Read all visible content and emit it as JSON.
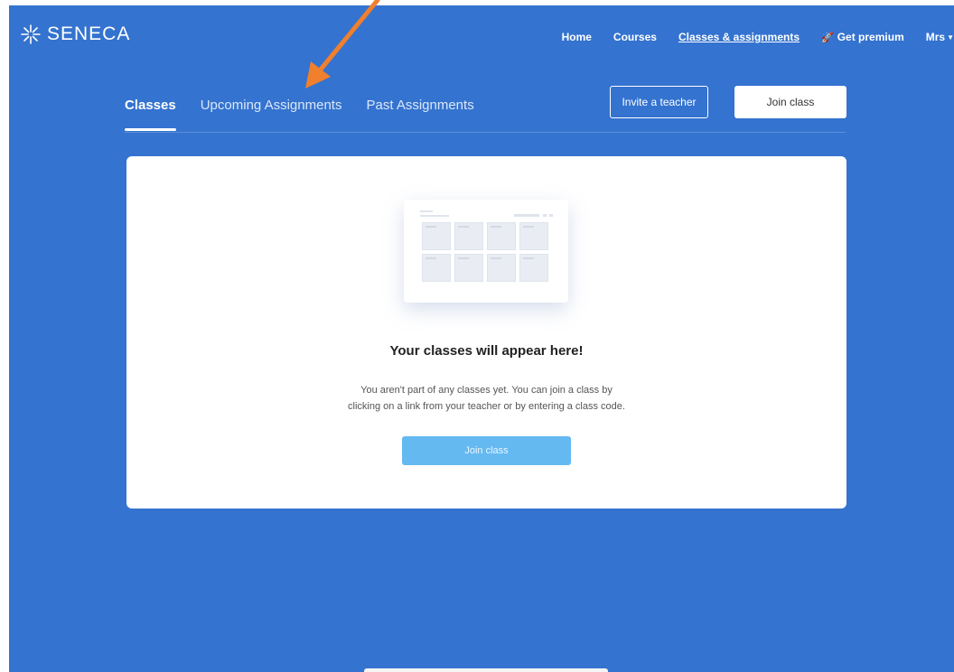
{
  "brand": {
    "name": "SENECA",
    "icon": "seneca-star-icon"
  },
  "nav": {
    "home": "Home",
    "courses": "Courses",
    "classes": "Classes & assignments",
    "premium": "Get premium",
    "premium_icon": "rocket-icon",
    "user": "Mrs",
    "user_icon": "caret-down-icon"
  },
  "tabs": {
    "classes": "Classes",
    "upcoming": "Upcoming Assignments",
    "past": "Past Assignments"
  },
  "actions": {
    "invite": "Invite a teacher",
    "join": "Join class"
  },
  "empty_state": {
    "title": "Your classes will appear here!",
    "line1": "You aren't part of any classes yet. You can join a class by",
    "line2": "clicking on a link from your teacher or by entering a class code.",
    "button": "Join class"
  },
  "colors": {
    "background": "#3473cf",
    "card": "#ffffff",
    "join_button": "#65b9f1",
    "annotation_arrow": "#f07f2e"
  }
}
